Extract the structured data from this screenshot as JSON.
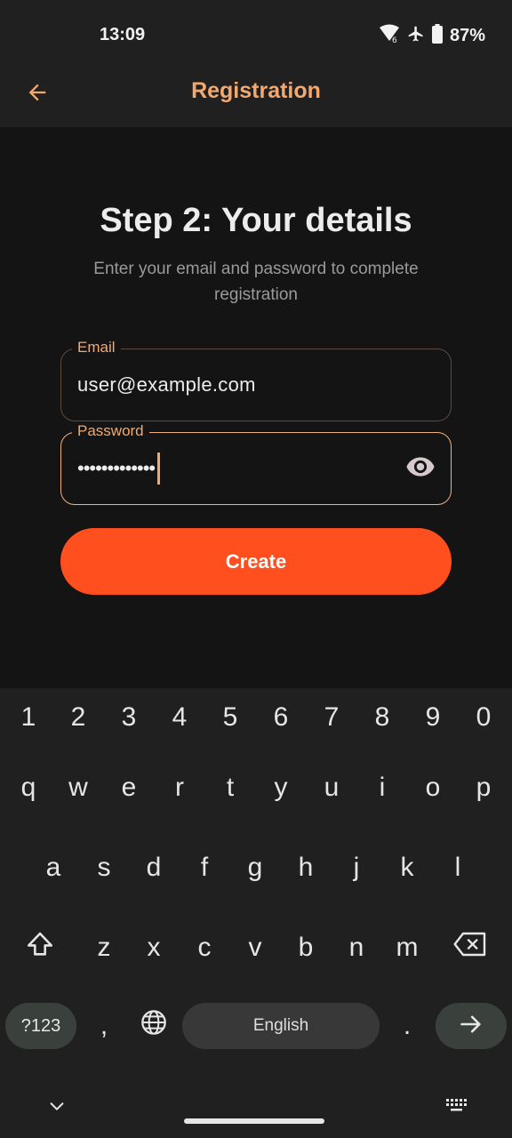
{
  "status_bar": {
    "time": "13:09",
    "battery": "87%",
    "icons": [
      "wifi-signal-icon",
      "airplane-icon",
      "battery-icon"
    ]
  },
  "app_bar": {
    "title": "Registration",
    "back_icon": "arrow-left-icon"
  },
  "form": {
    "title": "Step 2: Your details",
    "subtitle": "Enter your email and password to complete registration",
    "email": {
      "label": "Email",
      "value": "user@example.com"
    },
    "password": {
      "label": "Password",
      "masked_value": "•••••••••••••",
      "toggle_icon": "eye-icon"
    },
    "submit_label": "Create"
  },
  "keyboard": {
    "row_numbers": [
      "1",
      "2",
      "3",
      "4",
      "5",
      "6",
      "7",
      "8",
      "9",
      "0"
    ],
    "row_1": [
      "q",
      "w",
      "e",
      "r",
      "t",
      "y",
      "u",
      "i",
      "o",
      "p"
    ],
    "row_2": [
      "a",
      "s",
      "d",
      "f",
      "g",
      "h",
      "j",
      "k",
      "l"
    ],
    "row_3": [
      "z",
      "x",
      "c",
      "v",
      "b",
      "n",
      "m"
    ],
    "symbols_label": "?123",
    "comma": ",",
    "period": ".",
    "space_label": "English",
    "icons": [
      "shift-icon",
      "backspace-icon",
      "globe-icon",
      "enter-arrow-icon",
      "chevron-down-icon",
      "keyboard-icon"
    ]
  },
  "colors": {
    "accent": "#f3a86e",
    "button": "#ff4f1f",
    "background": "#141414",
    "bar": "#202020"
  }
}
